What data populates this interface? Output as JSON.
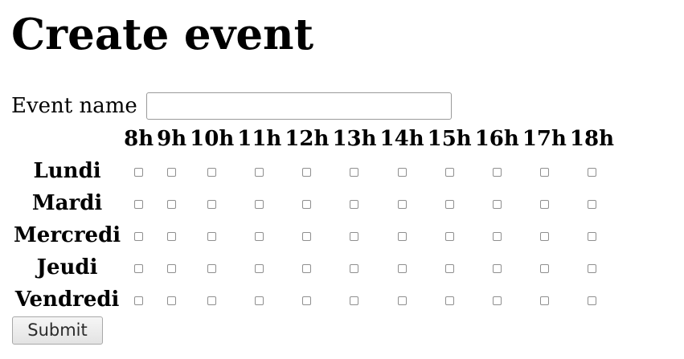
{
  "page": {
    "title": "Create event"
  },
  "form": {
    "event_name_label": "Event name",
    "event_name_value": "",
    "event_name_placeholder": "",
    "submit_label": "Submit"
  },
  "schedule": {
    "hours": [
      "8h",
      "9h",
      "10h",
      "11h",
      "12h",
      "13h",
      "14h",
      "15h",
      "16h",
      "17h",
      "18h"
    ],
    "days": [
      "Lundi",
      "Mardi",
      "Mercredi",
      "Jeudi",
      "Vendredi"
    ],
    "checked": [
      [
        false,
        false,
        false,
        false,
        false,
        false,
        false,
        false,
        false,
        false,
        false
      ],
      [
        false,
        false,
        false,
        false,
        false,
        false,
        false,
        false,
        false,
        false,
        false
      ],
      [
        false,
        false,
        false,
        false,
        false,
        false,
        false,
        false,
        false,
        false,
        false
      ],
      [
        false,
        false,
        false,
        false,
        false,
        false,
        false,
        false,
        false,
        false,
        false
      ],
      [
        false,
        false,
        false,
        false,
        false,
        false,
        false,
        false,
        false,
        false,
        false
      ]
    ]
  }
}
